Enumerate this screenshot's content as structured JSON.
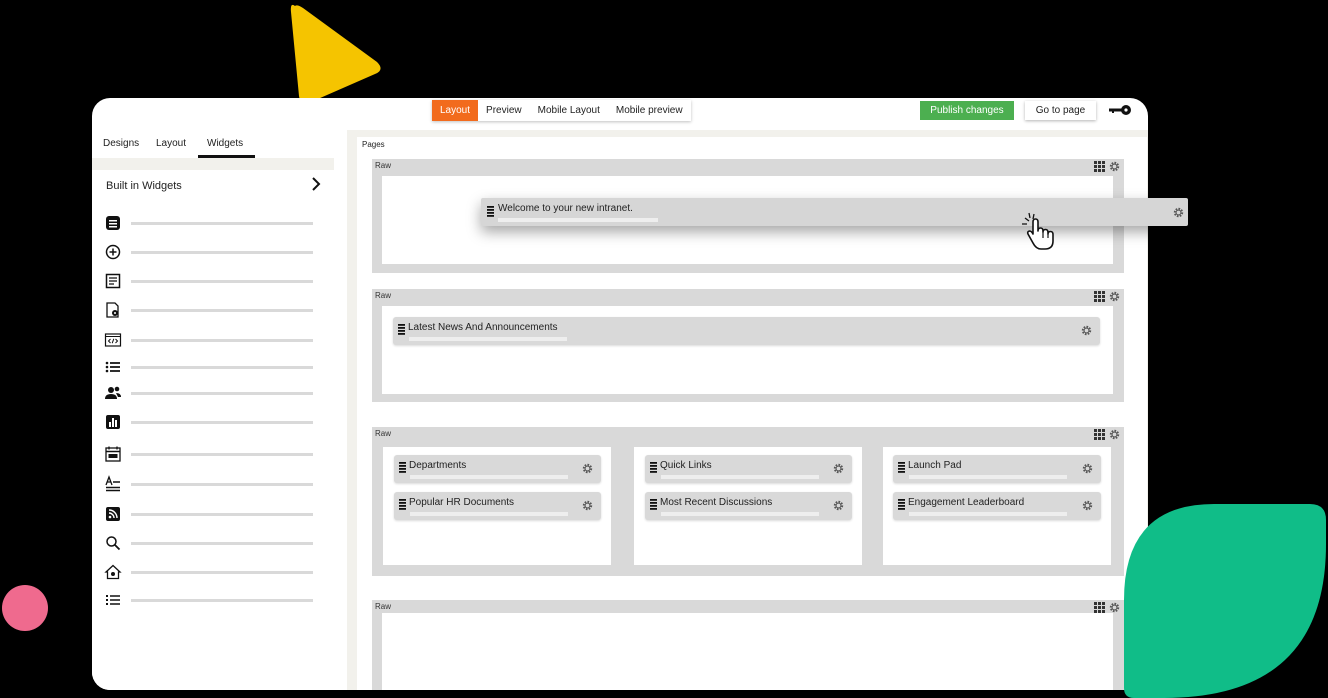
{
  "toolbar": {
    "tabs": [
      {
        "label": "Layout",
        "active": true
      },
      {
        "label": "Preview",
        "active": false
      },
      {
        "label": "Mobile Layout",
        "active": false
      },
      {
        "label": "Mobile preview",
        "active": false
      }
    ],
    "publish_label": "Publish changes",
    "goto_label": "Go to page",
    "key_icon": "key-icon"
  },
  "left_panel": {
    "tabs": [
      {
        "label": "Designs",
        "active": false
      },
      {
        "label": "Layout",
        "active": false
      },
      {
        "label": "Widgets",
        "active": true
      }
    ],
    "heading": "Built in Widgets",
    "widget_icons": [
      "list-box-icon",
      "plus-circle-icon",
      "document-icon",
      "file-settings-icon",
      "code-icon",
      "bullet-list-icon",
      "users-icon",
      "bar-chart-icon",
      "calendar-icon",
      "text-align-icon",
      "rss-icon",
      "search-icon",
      "house-icon",
      "numbered-list-icon"
    ]
  },
  "canvas": {
    "pages_label": "Pages",
    "rows": [
      {
        "label": "Raw",
        "widgets": []
      },
      {
        "label": "Raw",
        "widgets": [
          "Latest News And Announcements"
        ]
      },
      {
        "label": "Raw",
        "columns": [
          [
            "Departments",
            "Popular HR Documents"
          ],
          [
            "Quick Links",
            "Most Recent Discussions"
          ],
          [
            "Launch Pad",
            "Engagement Leaderboard"
          ]
        ]
      },
      {
        "label": "Raw",
        "widgets": []
      }
    ],
    "dragging_widget": "Welcome to your new intranet."
  },
  "colors": {
    "accent_orange": "#f26b1d",
    "publish_green": "#4caf50",
    "deco_yellow": "#f5c400",
    "deco_pink": "#ef6a8e",
    "deco_green": "#10bd88"
  }
}
